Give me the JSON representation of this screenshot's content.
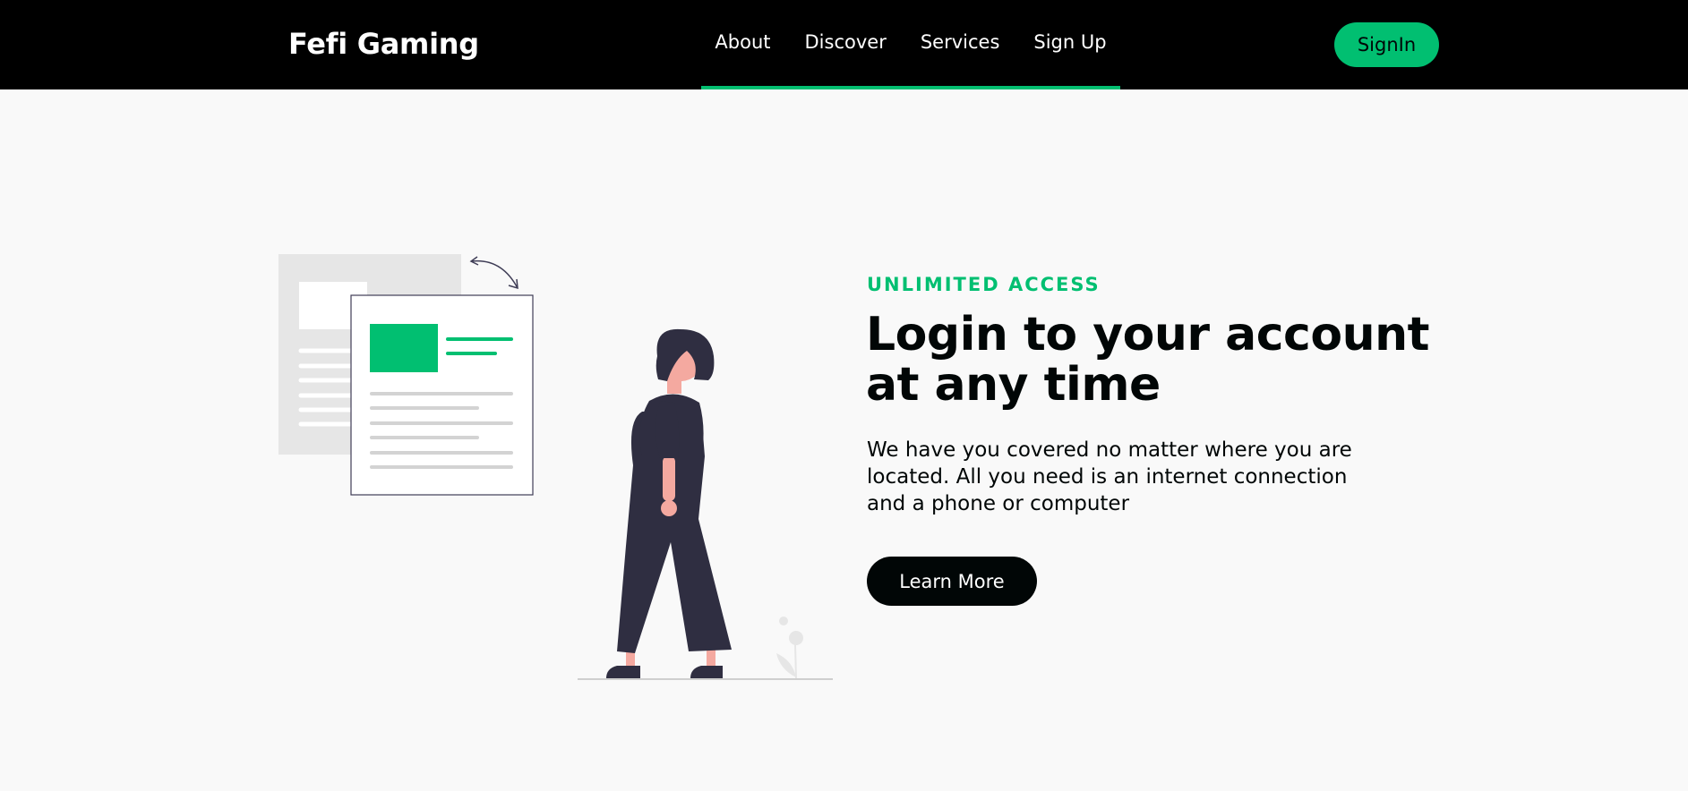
{
  "navbar": {
    "brand": "Fefi Gaming",
    "links": [
      "About",
      "Discover",
      "Services",
      "Sign Up"
    ],
    "signin_label": "SignIn"
  },
  "hero": {
    "topline": "UNLIMITED ACCESS",
    "heading": "Login to your account at any time",
    "subtitle": "We have you covered no matter where you are located. All you need is an internet connection and a phone or computer",
    "button_label": "Learn More"
  },
  "colors": {
    "accent": "#01bf71",
    "dark": "#010606",
    "background": "#f9f9f9",
    "navbar": "#000000"
  },
  "illustration": {
    "icon": "woman-with-documents-illustration"
  }
}
